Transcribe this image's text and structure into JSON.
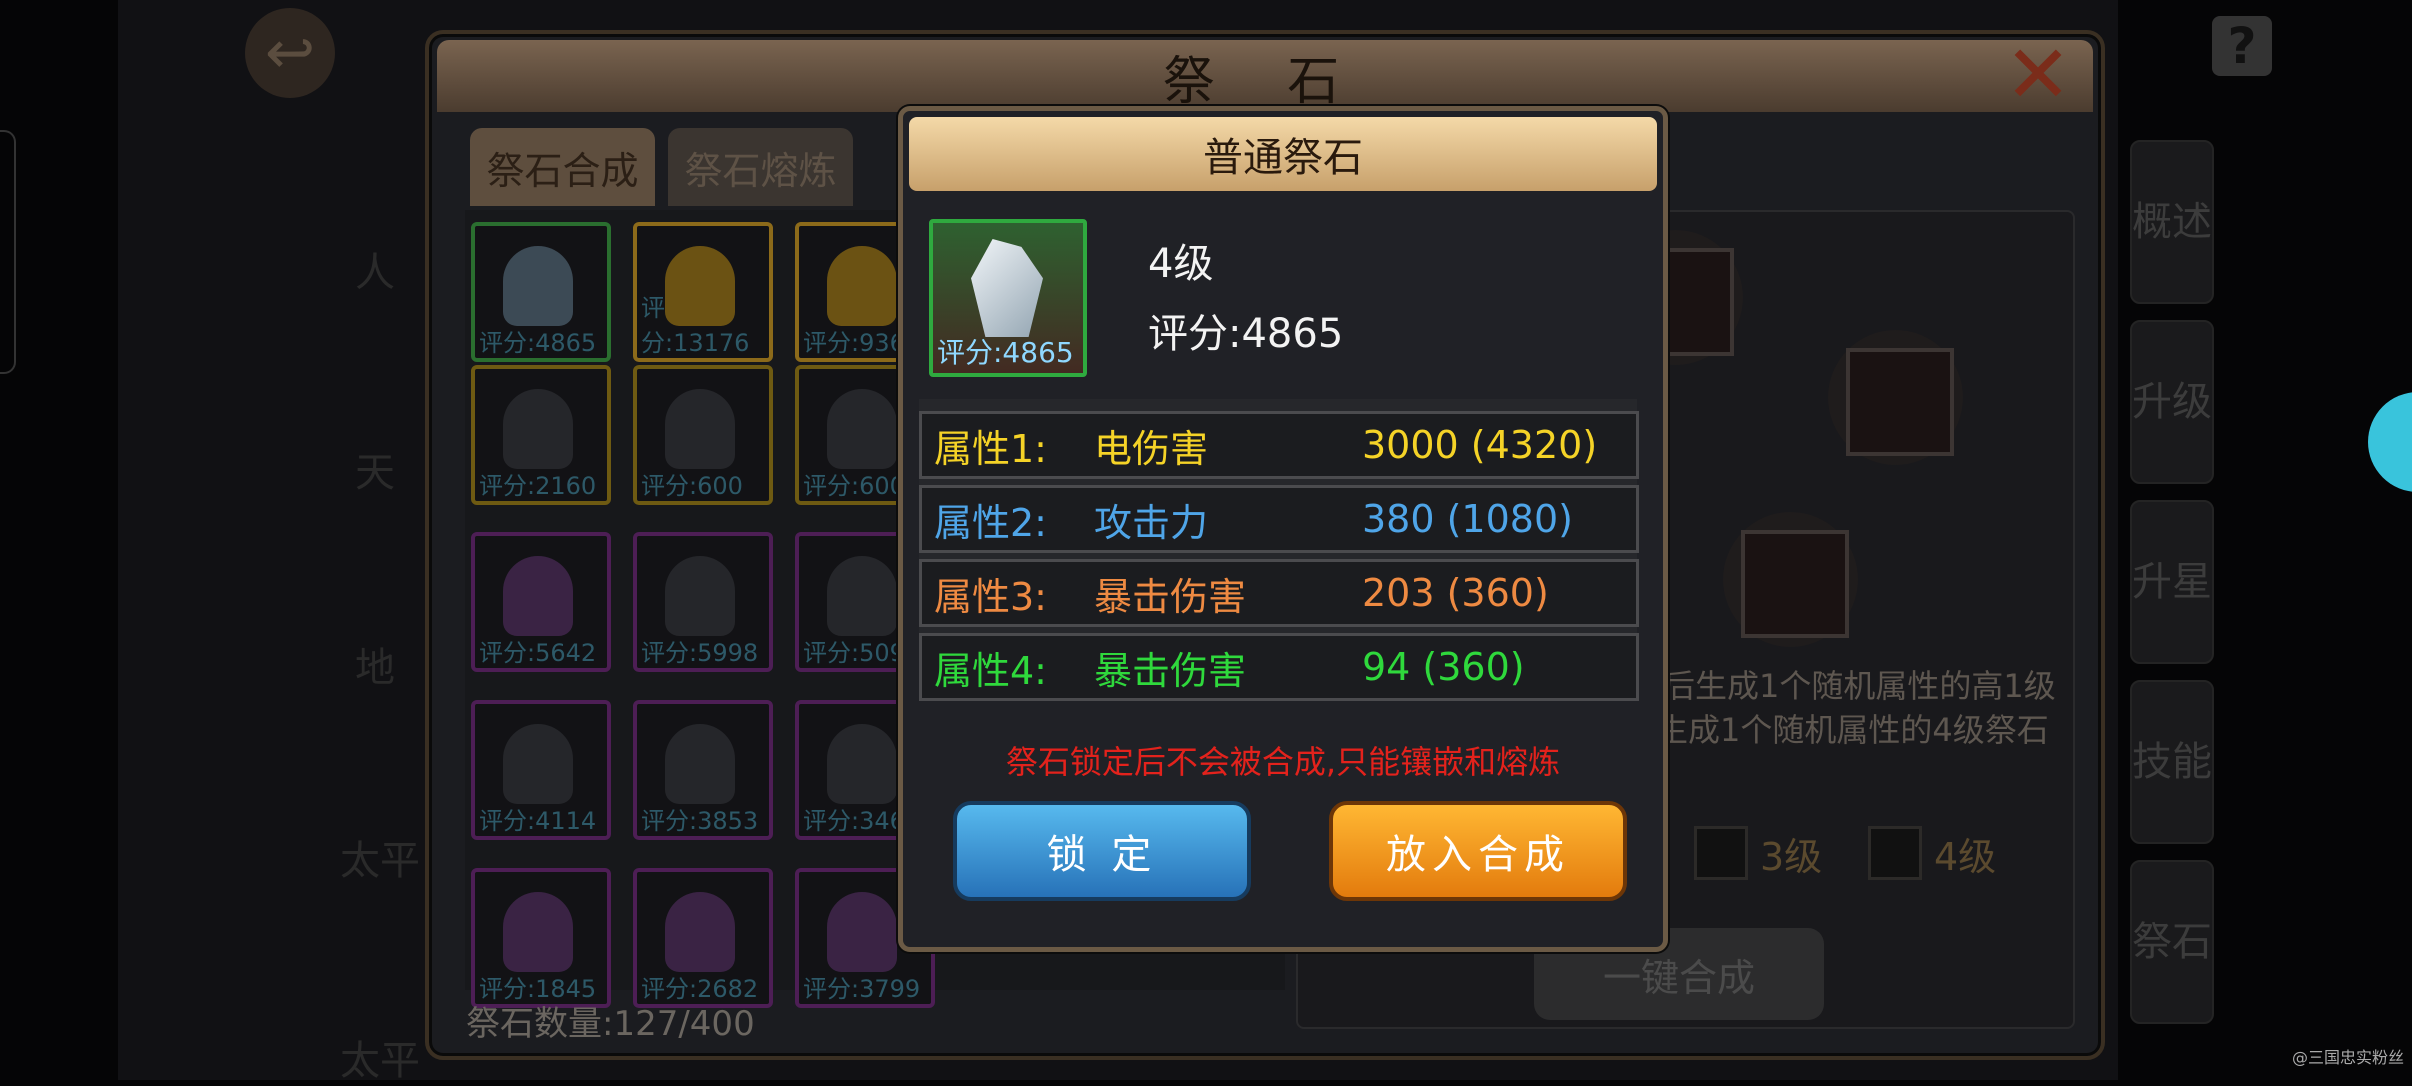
{
  "background": {
    "window_title": "祭 石",
    "tabs": [
      {
        "label": "祭石合成"
      },
      {
        "label": "祭石熔炼"
      }
    ],
    "stone_count": "祭石数量:127/400",
    "slot_scores": [
      [
        "评分:4865",
        "评分:13176",
        "评分:936"
      ],
      [
        "评分:2160",
        "评分:600",
        "评分:600"
      ],
      [
        "评分:5642",
        "评分:5998",
        "评分:509"
      ],
      [
        "评分:4114",
        "评分:3853",
        "评分:346"
      ],
      [
        "评分:1845",
        "评分:2682",
        "评分:3799"
      ]
    ],
    "right_text_line1": "后生成1个随机属性的高1级",
    "right_text_line2": "生成1个随机属性的4级祭石",
    "level_options": [
      "3级",
      "4级"
    ],
    "one_key_button": "一键合成",
    "side_tabs": [
      "概述",
      "升级",
      "升星",
      "技能",
      "祭石"
    ],
    "left_labels": [
      "人",
      "天",
      "地",
      "太平",
      "太平"
    ],
    "help_icon_label": "?",
    "watermark": "@三国忠实粉丝"
  },
  "popup": {
    "title": "普通祭石",
    "icon_score": "评分:4865",
    "level": "4级",
    "score": "评分:4865",
    "attributes": [
      {
        "label": "属性1:",
        "name": "电伤害",
        "value": "3000 (4320)",
        "color": "#f5d327"
      },
      {
        "label": "属性2:",
        "name": "攻击力",
        "value": "380 (1080)",
        "color": "#4fa5e8"
      },
      {
        "label": "属性3:",
        "name": "暴击伤害",
        "value": "203 (360)",
        "color": "#ee8a42"
      },
      {
        "label": "属性4:",
        "name": "暴击伤害",
        "value": "94 (360)",
        "color": "#2fd93c"
      }
    ],
    "note": "祭石锁定后不会被合成,只能镶嵌和熔炼",
    "lock_button": "锁 定",
    "merge_button": "放入合成"
  }
}
